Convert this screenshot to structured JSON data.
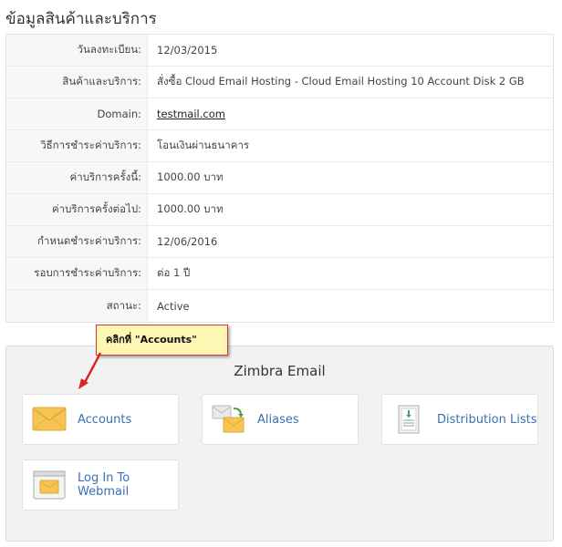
{
  "page": {
    "title": "ข้อมูลสินค้าและบริการ"
  },
  "details": [
    {
      "label": "วันลงทะเบียน:",
      "value": "12/03/2015"
    },
    {
      "label": "สินค้าและบริการ:",
      "value": "สั่งซื้อ Cloud Email Hosting - Cloud Email Hosting 10 Account Disk 2 GB"
    },
    {
      "label": "Domain:",
      "value": "testmail.com"
    },
    {
      "label": "วิธีการชำระค่าบริการ:",
      "value": "โอนเงินผ่านธนาคาร"
    },
    {
      "label": "ค่าบริการครั้งนี้:",
      "value": "1000.00 บาท"
    },
    {
      "label": "ค่าบริการครั้งต่อไป:",
      "value": "1000.00 บาท"
    },
    {
      "label": "กำหนดชำระค่าบริการ:",
      "value": "12/06/2016"
    },
    {
      "label": "รอบการชำระค่าบริการ:",
      "value": "ต่อ 1 ปี"
    },
    {
      "label": "สถานะ:",
      "value": "Active"
    }
  ],
  "panel": {
    "title": "Zimbra Email",
    "tiles": [
      {
        "label": "Accounts",
        "icon": "envelope-icon"
      },
      {
        "label": "Aliases",
        "icon": "forward-mail-icon"
      },
      {
        "label": "Distribution Lists",
        "icon": "document-list-icon"
      },
      {
        "label": "Log In To Webmail",
        "icon": "webmail-window-icon"
      }
    ]
  },
  "callout": {
    "text": "คลิกที่ \"Accounts\""
  },
  "colors": {
    "link": "#3a6fb0",
    "panel_bg": "#f2f2f2",
    "callout_bg": "#fdf7b3",
    "callout_border": "#dd3333"
  }
}
